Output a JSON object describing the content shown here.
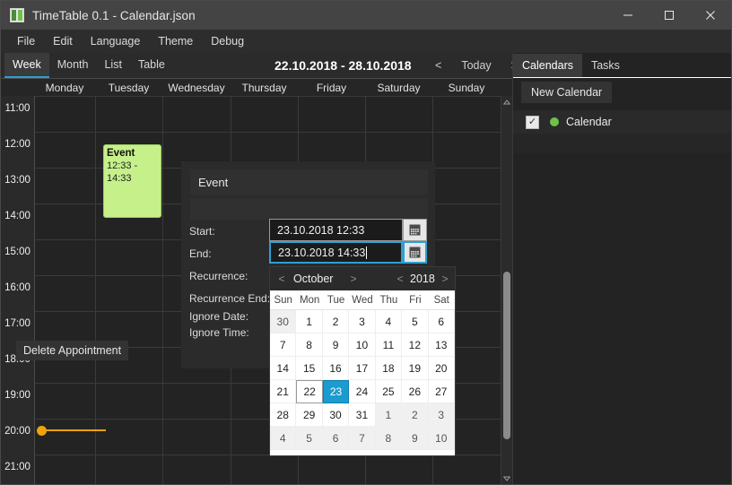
{
  "window": {
    "title": "TimeTable 0.1 - Calendar.json",
    "app_icon": "app-window-icon",
    "minimize": "minimize-icon",
    "maximize": "maximize-icon",
    "close": "close-icon"
  },
  "menubar": {
    "items": [
      "File",
      "Edit",
      "Language",
      "Theme",
      "Debug"
    ]
  },
  "toolbar": {
    "view_tabs": [
      "Week",
      "Month",
      "List",
      "Table"
    ],
    "active_view": "Week",
    "date_range": "22.10.2018 - 28.10.2018",
    "prev_label": "<",
    "today_label": "Today",
    "next_label": ">"
  },
  "calendar": {
    "day_headers": [
      "Monday",
      "Tuesday",
      "Wednesday",
      "Thursday",
      "Friday",
      "Saturday",
      "Sunday"
    ],
    "time_labels": [
      "11:00",
      "12:00",
      "13:00",
      "14:00",
      "15:00",
      "16:00",
      "17:00",
      "18:00",
      "19:00",
      "20:00",
      "21:00"
    ],
    "event": {
      "title": "Event",
      "time": "12:33 - 14:33",
      "color": "#c6f08a"
    },
    "now_marker": {
      "color": "#f0a30a",
      "time": "20:00"
    }
  },
  "dialog": {
    "title": "Event",
    "description": "",
    "labels": {
      "start": "Start:",
      "end": "End:",
      "recurrence": "Recurrence:",
      "recurrence_end": "Recurrence End:",
      "ignore_date": "Ignore Date:",
      "ignore_time": "Ignore Time:"
    },
    "start_value": "23.10.2018 12:33",
    "end_value": "23.10.2018 14:33",
    "delete_label": "Delete Appointment",
    "calendar_icon": "calendar-picker-icon"
  },
  "datepicker": {
    "month": "October",
    "year": "2018",
    "prev_month": "<",
    "next_month": ">",
    "prev_year": "<",
    "next_year": ">",
    "dow": [
      "Sun",
      "Mon",
      "Tue",
      "Wed",
      "Thu",
      "Fri",
      "Sat"
    ],
    "weeks": [
      [
        {
          "d": "30",
          "t": "other"
        },
        {
          "d": "1",
          "t": "cur"
        },
        {
          "d": "2",
          "t": "cur"
        },
        {
          "d": "3",
          "t": "cur"
        },
        {
          "d": "4",
          "t": "cur"
        },
        {
          "d": "5",
          "t": "cur"
        },
        {
          "d": "6",
          "t": "cur"
        }
      ],
      [
        {
          "d": "7",
          "t": "cur"
        },
        {
          "d": "8",
          "t": "cur"
        },
        {
          "d": "9",
          "t": "cur"
        },
        {
          "d": "10",
          "t": "cur"
        },
        {
          "d": "11",
          "t": "cur"
        },
        {
          "d": "12",
          "t": "cur"
        },
        {
          "d": "13",
          "t": "cur"
        }
      ],
      [
        {
          "d": "14",
          "t": "cur"
        },
        {
          "d": "15",
          "t": "cur"
        },
        {
          "d": "16",
          "t": "cur"
        },
        {
          "d": "17",
          "t": "cur"
        },
        {
          "d": "18",
          "t": "cur"
        },
        {
          "d": "19",
          "t": "cur"
        },
        {
          "d": "20",
          "t": "cur"
        }
      ],
      [
        {
          "d": "21",
          "t": "cur"
        },
        {
          "d": "22",
          "t": "today"
        },
        {
          "d": "23",
          "t": "selected"
        },
        {
          "d": "24",
          "t": "cur"
        },
        {
          "d": "25",
          "t": "cur"
        },
        {
          "d": "26",
          "t": "cur"
        },
        {
          "d": "27",
          "t": "cur"
        }
      ],
      [
        {
          "d": "28",
          "t": "cur"
        },
        {
          "d": "29",
          "t": "cur"
        },
        {
          "d": "30",
          "t": "cur"
        },
        {
          "d": "31",
          "t": "cur"
        },
        {
          "d": "1",
          "t": "other"
        },
        {
          "d": "2",
          "t": "other"
        },
        {
          "d": "3",
          "t": "other"
        }
      ],
      [
        {
          "d": "4",
          "t": "other"
        },
        {
          "d": "5",
          "t": "other"
        },
        {
          "d": "6",
          "t": "other"
        },
        {
          "d": "7",
          "t": "other"
        },
        {
          "d": "8",
          "t": "other"
        },
        {
          "d": "9",
          "t": "other"
        },
        {
          "d": "10",
          "t": "other"
        }
      ]
    ]
  },
  "right_panel": {
    "tabs": [
      "Calendars",
      "Tasks"
    ],
    "active_tab": "Calendars",
    "new_calendar_label": "New Calendar",
    "calendars": [
      {
        "name": "Calendar",
        "checked": true,
        "color": "#6ec24a",
        "check_glyph": "✓"
      }
    ]
  }
}
